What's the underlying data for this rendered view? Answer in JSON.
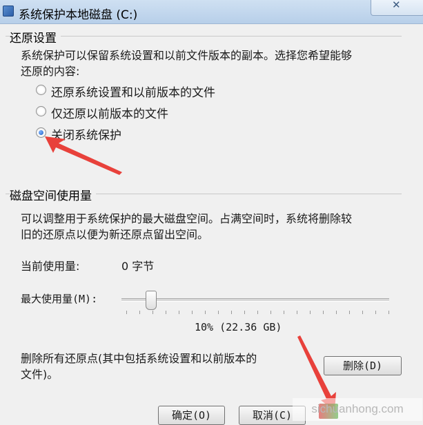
{
  "window": {
    "title": "系统保护本地磁盘 (C:)"
  },
  "restore": {
    "legend": "还原设置",
    "description_line1": "系统保护可以保留系统设置和以前文件版本的副本。选择您希望能够",
    "description_line2": "还原的内容:",
    "options": [
      {
        "label": "还原系统设置和以前版本的文件",
        "checked": false
      },
      {
        "label": "仅还原以前版本的文件",
        "checked": false
      },
      {
        "label": "关闭系统保护",
        "checked": true
      }
    ]
  },
  "disk": {
    "legend": "磁盘空间使用量",
    "description_line1": "可以调整用于系统保护的最大磁盘空间。占满空间时，系统将删除较",
    "description_line2": "旧的还原点以便为新还原点留出空间。",
    "current_usage_label": "当前使用量:",
    "current_usage_value": "0 字节",
    "max_usage_label": "最大使用量(M):",
    "max_usage_percent": 10,
    "max_usage_readout": "10% (22.36 GB)",
    "delete_text_line1": "删除所有还原点(其中包括系统设置和以前版本的",
    "delete_text_line2": "文件)。",
    "delete_button": "删除(D)"
  },
  "footer": {
    "ok_button": "确定(O)",
    "cancel_button": "取消(C)"
  },
  "watermark": {
    "text": "sichuanhong.com"
  },
  "colors": {
    "arrow": "#e8413b",
    "accent": "#1d5fc4"
  }
}
